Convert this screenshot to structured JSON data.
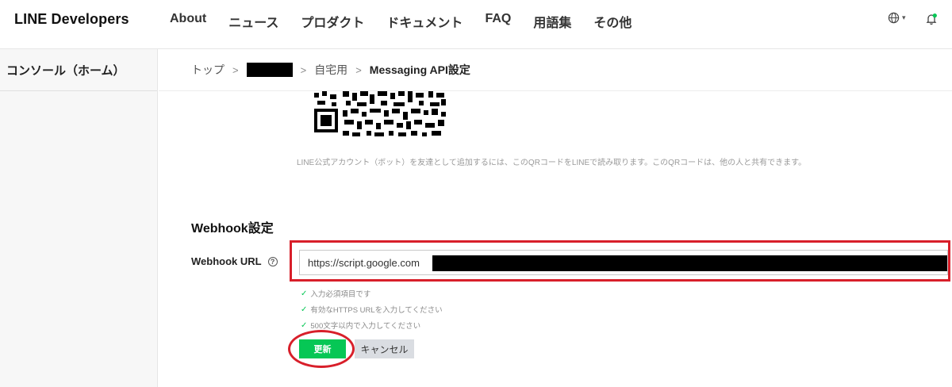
{
  "header": {
    "logo": "LINE Developers",
    "nav": [
      "About",
      "ニュース",
      "プロダクト",
      "ドキュメント",
      "FAQ",
      "用語集",
      "その他"
    ],
    "language_icon": "globe-icon",
    "notification_icon": "bell-icon",
    "notification_dot_color": "#06c755"
  },
  "sidebar": {
    "items": [
      {
        "label": "コンソール（ホーム）"
      }
    ]
  },
  "breadcrumb": {
    "items": [
      "トップ",
      "自宅用",
      "Messaging API設定"
    ]
  },
  "qr_section": {
    "hint": "LINE公式アカウント（ボット）を友達として追加するには、このQRコードをLINEで読み取ります。このQRコードは、他の人と共有できます。"
  },
  "webhook": {
    "title": "Webhook設定",
    "label": "Webhook URL",
    "url_value": "https://script.google.com",
    "validations": [
      "入力必須項目です",
      "有効なHTTPS URLを入力してください",
      "500文字以内で入力してください"
    ],
    "update_label": "更新",
    "cancel_label": "キャンセル"
  },
  "colors": {
    "accent_green": "#06c755",
    "highlight_red": "#d81f2a"
  }
}
